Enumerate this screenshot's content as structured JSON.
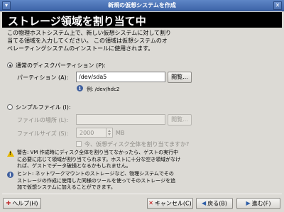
{
  "window": {
    "title": "新規の仮想システムを作成"
  },
  "header": {
    "title": "ストレージ領域を割り当て中"
  },
  "intro": {
    "line1": "この物理ホストシステム上で、新しい仮想システムに対して割り",
    "line2": "当てる領域を入力してください。 この領域は仮想システムのオ",
    "line3": "ペレーティングシステムのインストールに使用されます。"
  },
  "partition": {
    "radio_label": "通常のディスクパーティション (P):",
    "field_label": "パーティション (A):",
    "value": "/dev/sda5",
    "browse": "閲覧...",
    "example": "例: /dev/hdc2"
  },
  "simple_file": {
    "radio_label": "シンプルファイル (I):",
    "location_label": "ファイルの場所 (L):",
    "location_value": "",
    "browse": "閲覧...",
    "size_label": "ファイルサイズ (S):",
    "size_value": "2000",
    "size_unit": "MB",
    "allocate_label": "今、仮想ディスク全体を割り当てますか?"
  },
  "warning": {
    "line1": "警告: VM 作成時にディスク全体を割り当てなかったら、ゲストの実行中",
    "line2": "に必要に応じて領域が割り当てられます。ホストに十分な空き領域がなけ",
    "line3": "れば、ゲストでデータ破損となるかもしれません。"
  },
  "hint": {
    "line1": "ヒント: ネットワークマウントのストレージなど、物理システムでその",
    "line2": "ストレージの作成に使用した同様のツールを使ってそのストレージを追",
    "line3": "加で仮想システムに加えることができます。"
  },
  "buttons": {
    "help": "ヘルプ(H)",
    "cancel": "キャンセル(C)",
    "back": "戻る(B)",
    "forward": "進む(F)"
  }
}
